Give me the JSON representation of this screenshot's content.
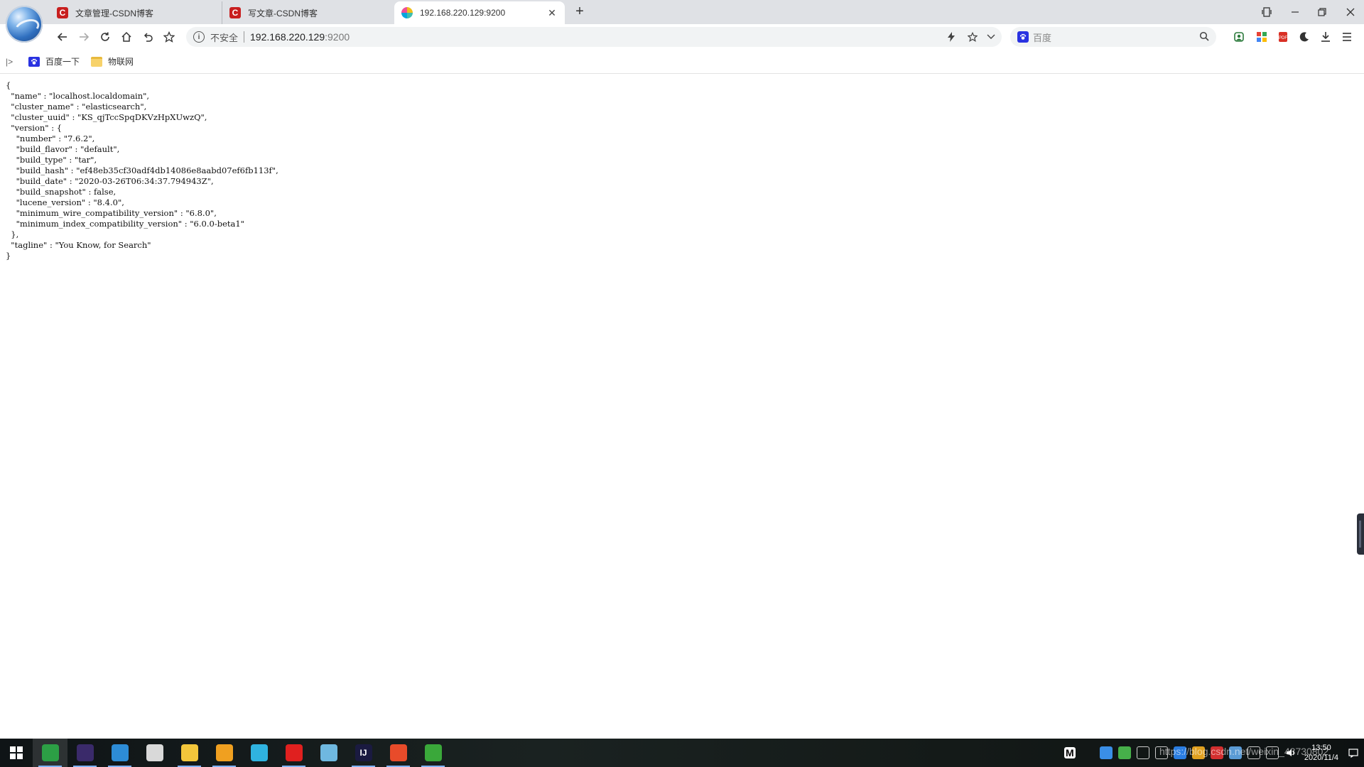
{
  "browser": {
    "tabs": [
      {
        "title": "文章管理-CSDN博客",
        "favicon": "csdn-icon",
        "active": false
      },
      {
        "title": "写文章-CSDN博客",
        "favicon": "csdn-icon",
        "active": false
      },
      {
        "title": "192.168.220.129:9200",
        "favicon": "elasticsearch-icon",
        "active": true
      }
    ],
    "tab_close_glyph": "✕",
    "new_tab_glyph": "+"
  },
  "toolbar": {
    "security_label": "不安全",
    "url_host": "192.168.220.129",
    "url_port": ":9200",
    "search_placeholder": "百度"
  },
  "bookmarks": {
    "toggle_glyph": "|>",
    "items": [
      {
        "label": "百度一下",
        "icon": "baidu-icon"
      },
      {
        "label": "物联网",
        "icon": "folder-icon"
      }
    ]
  },
  "page": {
    "json_text": "{\n  \"name\" : \"localhost.localdomain\",\n  \"cluster_name\" : \"elasticsearch\",\n  \"cluster_uuid\" : \"KS_qjTccSpqDKVzHpXUwzQ\",\n  \"version\" : {\n    \"number\" : \"7.6.2\",\n    \"build_flavor\" : \"default\",\n    \"build_type\" : \"tar\",\n    \"build_hash\" : \"ef48eb35cf30adf4db14086e8aabd07ef6fb113f\",\n    \"build_date\" : \"2020-03-26T06:34:37.794943Z\",\n    \"build_snapshot\" : false,\n    \"lucene_version\" : \"8.4.0\",\n    \"minimum_wire_compatibility_version\" : \"6.8.0\",\n    \"minimum_index_compatibility_version\" : \"6.0.0-beta1\"\n  },\n  \"tagline\" : \"You Know, for Search\"\n}"
  },
  "taskbar": {
    "apps": [
      {
        "name": "chrome-icon",
        "glyph": "",
        "color": "#2c9f45",
        "running": true,
        "active": true
      },
      {
        "name": "eclipse-icon",
        "glyph": "",
        "color": "#3a2a6a",
        "running": true,
        "active": false
      },
      {
        "name": "browser-icon",
        "glyph": "",
        "color": "#2d8cd6",
        "running": true,
        "active": false
      },
      {
        "name": "avatar-app-icon",
        "glyph": "",
        "color": "#d9d9d9",
        "running": false,
        "active": false
      },
      {
        "name": "file-explorer-icon",
        "glyph": "",
        "color": "#f3c63b",
        "running": true,
        "active": false
      },
      {
        "name": "vmware-icon",
        "glyph": "",
        "color": "#f0a020",
        "running": true,
        "active": false
      },
      {
        "name": "media-player-icon",
        "glyph": "",
        "color": "#2fb3e0",
        "running": false,
        "active": false
      },
      {
        "name": "netease-music-icon",
        "glyph": "",
        "color": "#e0201f",
        "running": true,
        "active": false
      },
      {
        "name": "notepad-icon",
        "glyph": "",
        "color": "#6fb8e0",
        "running": false,
        "active": false
      },
      {
        "name": "intellij-icon",
        "glyph": "IJ",
        "color": "#1a1a40",
        "running": true,
        "active": false
      },
      {
        "name": "snail-app-icon",
        "glyph": "",
        "color": "#e84b2a",
        "running": true,
        "active": false
      },
      {
        "name": "wechat-icon",
        "glyph": "",
        "color": "#3aa83a",
        "running": true,
        "active": false
      }
    ],
    "tray_m": "M",
    "clock_time": "13:50",
    "clock_date": "2020/11/4"
  },
  "overlay": {
    "watermark": "https://blog.csdn.net/weixin_43730802"
  }
}
